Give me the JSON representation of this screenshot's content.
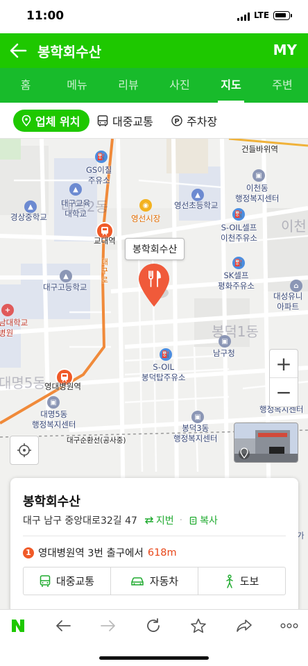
{
  "status": {
    "time": "11:00",
    "network": "LTE"
  },
  "header": {
    "title": "봉학회수산",
    "my_label": "MY"
  },
  "tabs": [
    {
      "label": "홈"
    },
    {
      "label": "메뉴"
    },
    {
      "label": "리뷰"
    },
    {
      "label": "사진"
    },
    {
      "label": "지도",
      "active": true
    },
    {
      "label": "주변"
    }
  ],
  "chips": {
    "location": "업체 위치",
    "transit": "대중교통",
    "parking": "주차장"
  },
  "map": {
    "pin_label": "봉학회수산",
    "pois": {
      "geondeul": "건들바위역",
      "gs": "GS이칠\n주유소",
      "daegu_univ": "대구교육\n대학교",
      "yeongseon_market": "영선시장",
      "yeongseon_school": "영선초등학교",
      "icheon_center": "이천동\n행정복지센터",
      "gyeongsang": "경상중학교",
      "gyodae": "교대역",
      "soil_icheon": "S-OIL셀프\n이천주유소",
      "daegu_high": "대구고등학교",
      "sk": "SK셀프\n평화주유소",
      "daeseong": "대성유니\n아파트",
      "univ_hospital": "남대학교\n병원",
      "namgu": "남구청",
      "soil_bongdeok": "S-OIL\n봉덕탑주유소",
      "yeongdae_station": "영대병원역",
      "daemyeong5": "대명5동\n행정복지센터",
      "bongdeok3": "봉덕3동\n행정복지센터",
      "haengjeong": "행정복지센터",
      "sunhwan": "대구순환선(공사중)",
      "road_name": "대구로",
      "right_edge": "가"
    },
    "areas": {
      "daemyeong2": "대명2동",
      "icheon": "이천",
      "bongdeok1": "봉덕1동",
      "daemyeong5": "대명5동"
    }
  },
  "card": {
    "name": "봉학회수산",
    "address": "대구 남구 중앙대로32길 47",
    "jibeon_label": "지번",
    "copy_label": "복사",
    "subway_badge": "1",
    "subway_text": "영대병원역 3번 출구에서",
    "subway_distance": "618m",
    "buttons": {
      "transit": "대중교통",
      "car": "자동차",
      "walk": "도보"
    }
  },
  "colors": {
    "brand_green": "#1ec800",
    "accent_orange": "#f05a28",
    "link_green": "#1eaa2e"
  }
}
